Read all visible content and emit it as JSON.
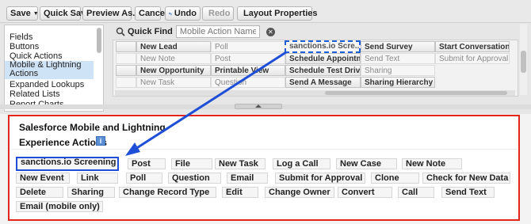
{
  "toolbar": {
    "save": "Save",
    "quick_save": "Quick Save",
    "preview_as": "Preview As...",
    "cancel": "Cancel",
    "undo": "Undo",
    "redo": "Redo",
    "layout_properties": "Layout Properties"
  },
  "left_nav": {
    "items": [
      "Fields",
      "Buttons",
      "Quick Actions",
      "Mobile & Lightning Actions",
      "Expanded Lookups",
      "Related Lists",
      "Report Charts"
    ],
    "selected_index": 3
  },
  "quick_find": {
    "label": "Quick Find",
    "placeholder": "Mobile Action Name"
  },
  "palette_rows": [
    [
      "",
      "New Lead",
      "Poll",
      "sanctions.io Scre...",
      "Send Survey",
      "Start Conversation"
    ],
    [
      "",
      "New Note",
      "Post",
      "Schedule Appointment",
      "Send Text",
      "Submit for Approval"
    ],
    [
      "",
      "New Opportunity",
      "Printable View",
      "Schedule Test Drive",
      "Sharing",
      ""
    ],
    [
      "",
      "New Task",
      "Question",
      "Send A Message",
      "Sharing Hierarchy",
      ""
    ]
  ],
  "section": {
    "title_line1": "Salesforce Mobile and Lightning",
    "title_line2": "Experience Actions",
    "actions": [
      "sanctions.io Screening",
      "Post",
      "File",
      "New Task",
      "Log a Call",
      "New Case",
      "New Note",
      "New Event",
      "Link",
      "Poll",
      "Question",
      "Email",
      "Submit for Approval",
      "Clone",
      "Check for New Data",
      "Delete",
      "Sharing",
      "Change Record Type",
      "Edit",
      "Change Owner",
      "Convert",
      "Call",
      "Send Text",
      "Email (mobile only)"
    ]
  },
  "colors": {
    "highlight_border": "#e3261c",
    "arrow": "#1f4fd6",
    "selected_nav": "#cfe3f7"
  }
}
